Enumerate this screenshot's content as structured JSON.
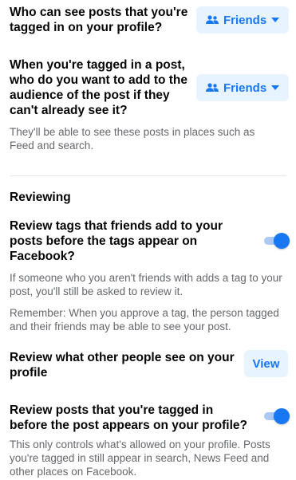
{
  "settings": {
    "tagged_posts_visibility": {
      "question": "Who can see posts that you're tagged in on your profile?",
      "value": "Friends",
      "icon": "friends-icon",
      "caret": "caret-down-icon"
    },
    "tag_audience": {
      "question": "When you're tagged in a post, who do you want to add to the audience of the post if they can't already see it?",
      "value": "Friends",
      "help": "They'll be able to see these posts in places such as Feed and search."
    }
  },
  "reviewing": {
    "title": "Reviewing",
    "review_tags": {
      "question": "Review tags that friends add to your posts before the tags appear on Facebook?",
      "enabled": true,
      "help1": "If someone who you aren't friends with adds a tag to your post, you'll still be asked to review it.",
      "help2": "Remember: When you approve a tag, the person tagged and their friends may be able to see your post."
    },
    "review_profile_view": {
      "question": "Review what other people see on your profile",
      "button": "View"
    },
    "review_tagged_posts": {
      "question": "Review posts that you're tagged in before the post appears on your profile?",
      "enabled": true,
      "help": "This only controls what's allowed on your profile. Posts you're tagged in still appear in search, News Feed and other places on Facebook."
    }
  },
  "colors": {
    "accent": "#1877f2",
    "pill_bg": "#e7f3ff",
    "secondary_text": "#65676b",
    "divider": "#e4e6eb"
  }
}
